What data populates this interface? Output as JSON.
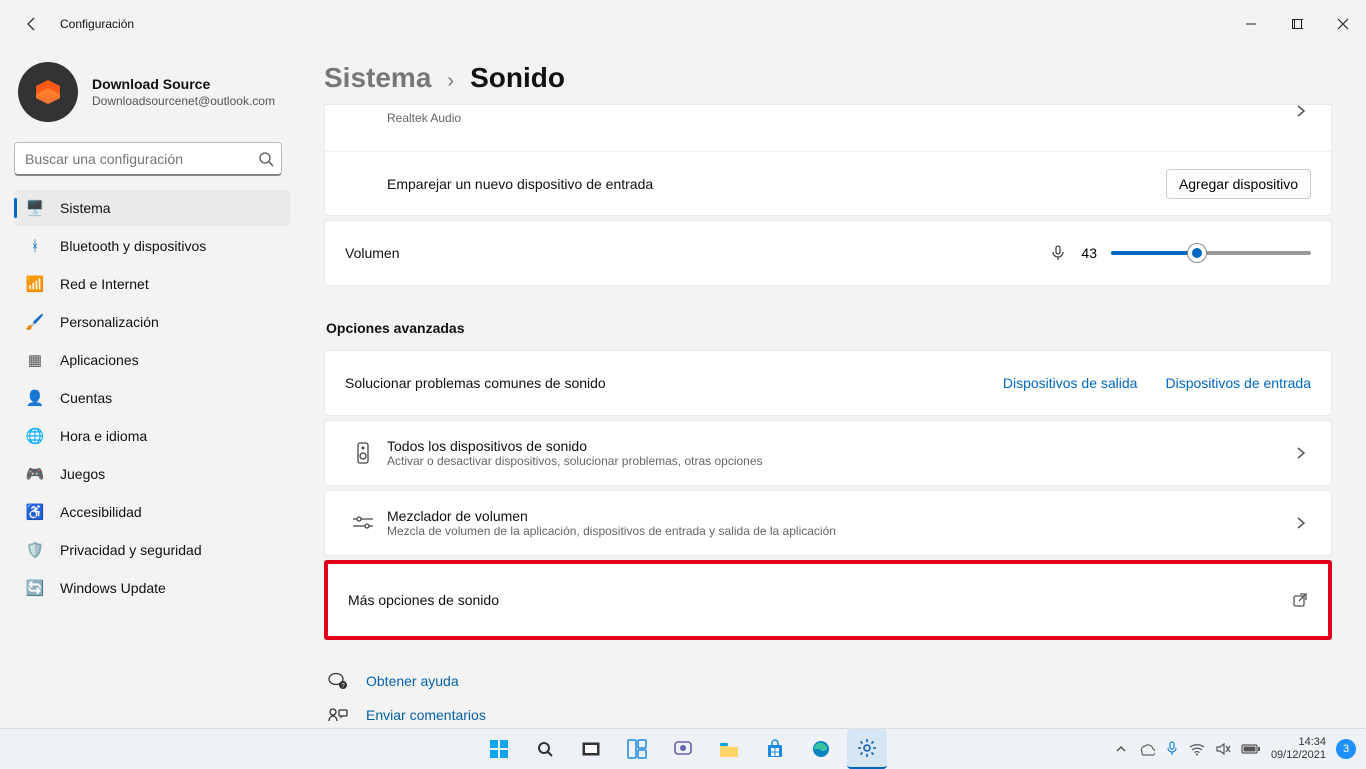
{
  "window": {
    "title": "Configuración"
  },
  "user": {
    "name": "Download Source",
    "email": "Downloadsourcenet@outlook.com"
  },
  "search": {
    "placeholder": "Buscar una configuración"
  },
  "nav": [
    {
      "label": "Sistema",
      "active": true,
      "icon": "🖥️",
      "color": "#0067c0"
    },
    {
      "label": "Bluetooth y dispositivos",
      "icon": "ᚼ",
      "color": "#0067c0"
    },
    {
      "label": "Red e Internet",
      "icon": "📶",
      "color": "#0390d8"
    },
    {
      "label": "Personalización",
      "icon": "🖌️",
      "color": "#8a5a2b"
    },
    {
      "label": "Aplicaciones",
      "icon": "▦",
      "color": "#555"
    },
    {
      "label": "Cuentas",
      "icon": "👤",
      "color": "#e39b00"
    },
    {
      "label": "Hora e idioma",
      "icon": "🌐",
      "color": "#2aa835"
    },
    {
      "label": "Juegos",
      "icon": "🎮",
      "color": "#777"
    },
    {
      "label": "Accesibilidad",
      "icon": "♿",
      "color": "#0067c0"
    },
    {
      "label": "Privacidad y seguridad",
      "icon": "🛡️",
      "color": "#888"
    },
    {
      "label": "Windows Update",
      "icon": "🔄",
      "color": "#0067c0"
    }
  ],
  "breadcrumb": {
    "parent": "Sistema",
    "sep": "›",
    "current": "Sonido"
  },
  "input_device": {
    "sub": "Realtek Audio"
  },
  "pair": {
    "label": "Emparejar un nuevo dispositivo de entrada",
    "button": "Agregar dispositivo"
  },
  "volume": {
    "label": "Volumen",
    "value": "43",
    "percent": 43
  },
  "advanced_header": "Opciones avanzadas",
  "troubleshoot": {
    "label": "Solucionar problemas comunes de sonido",
    "link_out": "Dispositivos de salida",
    "link_in": "Dispositivos de entrada"
  },
  "all_devices": {
    "title": "Todos los dispositivos de sonido",
    "sub": "Activar o desactivar dispositivos, solucionar problemas, otras opciones"
  },
  "mixer": {
    "title": "Mezclador de volumen",
    "sub": "Mezcla de volumen de la aplicación, dispositivos de entrada y salida de la aplicación"
  },
  "more_options": {
    "title": "Más opciones de sonido"
  },
  "help": {
    "get_help": "Obtener ayuda",
    "feedback": "Enviar comentarios"
  },
  "taskbar": {
    "time": "14:34",
    "date": "09/12/2021",
    "notif": "3"
  }
}
